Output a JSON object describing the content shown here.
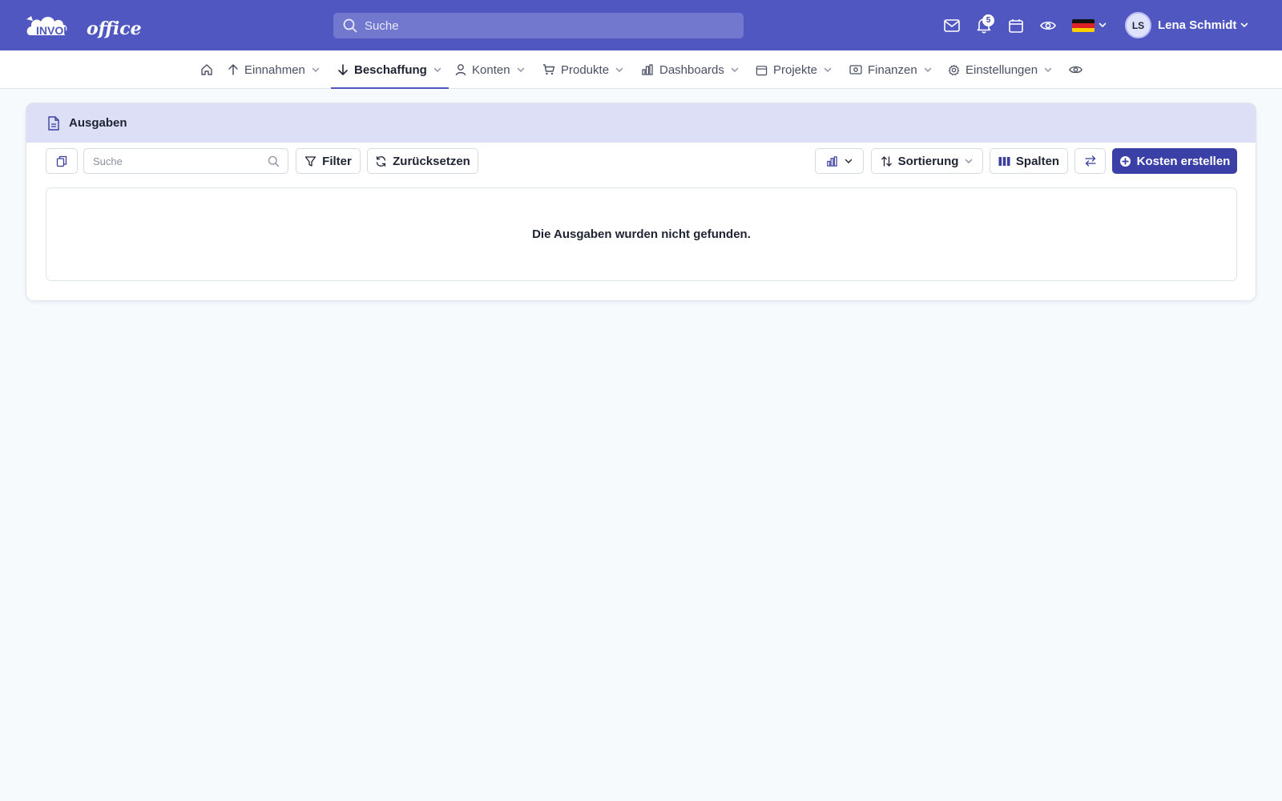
{
  "brand": {
    "logo_word1": "INVOICE",
    "logo_word2": "office",
    "primary_color": "#5157c0",
    "button_color": "#3b40a6"
  },
  "topbar": {
    "search_placeholder": "Suche",
    "icons": [
      "mail-icon",
      "bell-icon",
      "calendar-icon",
      "eye-icon"
    ],
    "notification_count": "5",
    "language_flag": "de",
    "user": {
      "initials": "LS",
      "name": "Lena Schmidt"
    }
  },
  "nav": {
    "items": [
      {
        "label": "",
        "icon": "home-icon"
      },
      {
        "label": "Einnahmen",
        "icon": "arrow-up-icon",
        "dropdown": true
      },
      {
        "label": "Beschaffung",
        "icon": "arrow-down-icon",
        "dropdown": true,
        "active": true
      },
      {
        "label": "Konten",
        "icon": "user-icon",
        "dropdown": true
      },
      {
        "label": "Produkte",
        "icon": "cart-icon",
        "dropdown": true
      },
      {
        "label": "Dashboards",
        "icon": "bar-chart-icon",
        "dropdown": true
      },
      {
        "label": "Projekte",
        "icon": "calendar-icon",
        "dropdown": true
      },
      {
        "label": "Finanzen",
        "icon": "money-icon",
        "dropdown": true
      },
      {
        "label": "Einstellungen",
        "icon": "gear-icon",
        "dropdown": true
      },
      {
        "label": "",
        "icon": "eye-icon"
      }
    ]
  },
  "page": {
    "title": "Ausgaben",
    "toolbar": {
      "search_placeholder": "Suche",
      "filter_label": "Filter",
      "reset_label": "Zurücksetzen",
      "sort_label": "Sortierung",
      "columns_label": "Spalten",
      "create_label": "Kosten erstellen"
    },
    "empty_message": "Die Ausgaben wurden nicht gefunden."
  }
}
